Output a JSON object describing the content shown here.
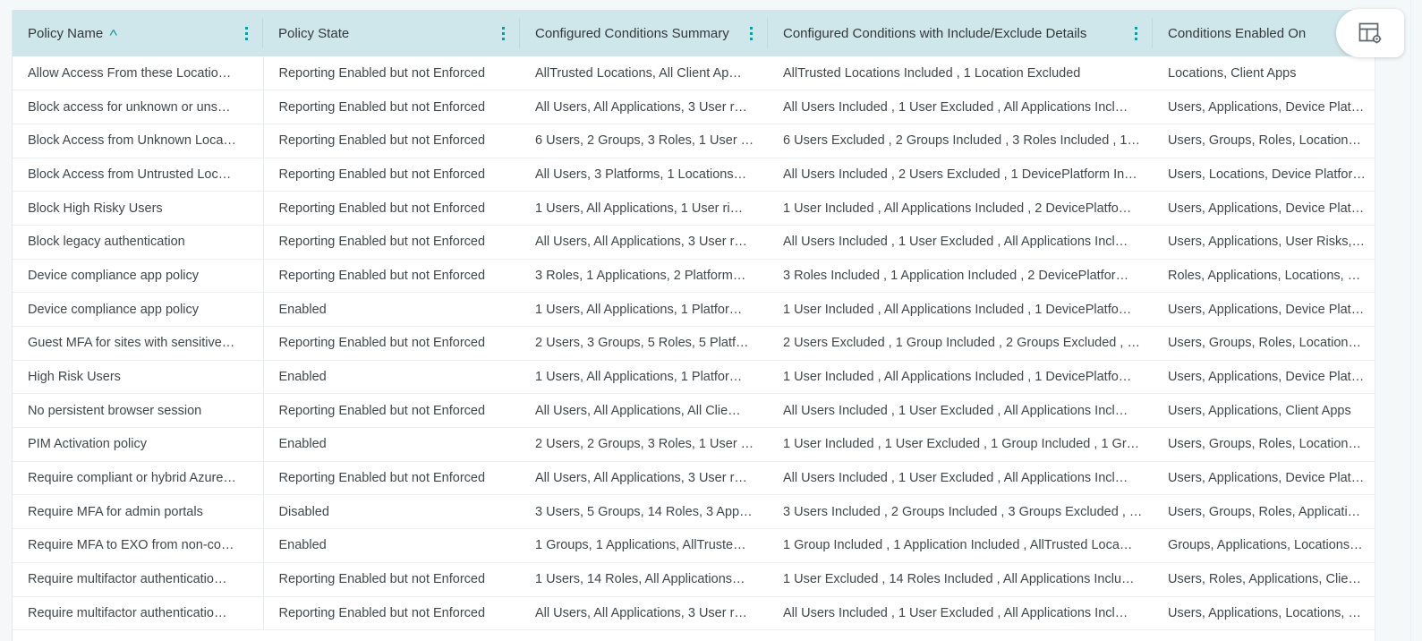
{
  "table": {
    "columns": [
      {
        "label": "Policy Name",
        "sorted": true,
        "sort_direction": "ascending",
        "sort_glyph": "˄",
        "has_menu": true
      },
      {
        "label": "Policy State",
        "sorted": false,
        "has_menu": true
      },
      {
        "label": "Configured Conditions Summary",
        "sorted": false,
        "has_menu": true
      },
      {
        "label": "Configured Conditions with Include/Exclude Details",
        "sorted": false,
        "has_menu": true
      },
      {
        "label": "Conditions Enabled On",
        "sorted": false,
        "has_menu": false
      }
    ],
    "rows": [
      {
        "policy_name": "Allow Access From these Locatio…",
        "policy_state": "Reporting Enabled but not Enforced",
        "conditions_summary": "AllTrusted Locations, All Client Ap…",
        "conditions_details": "AllTrusted Locations Included , 1 Location Excluded",
        "conditions_enabled_on": "Locations, Client Apps"
      },
      {
        "policy_name": "Block access for unknown or uns…",
        "policy_state": "Reporting Enabled but not Enforced",
        "conditions_summary": "All Users, All Applications, 3 User r…",
        "conditions_details": "All Users Included , 1 User Excluded , All Applications Incl…",
        "conditions_enabled_on": "Users, Applications, Device Platfor…"
      },
      {
        "policy_name": "Block Access from Unknown Loca…",
        "policy_state": "Reporting Enabled but not Enforced",
        "conditions_summary": "6 Users, 2 Groups, 3 Roles, 1 User …",
        "conditions_details": "6 Users Excluded , 2 Groups Included , 3 Roles Included , 1…",
        "conditions_enabled_on": "Users, Groups, Roles, Locations, D…"
      },
      {
        "policy_name": "Block Access from Untrusted Loc…",
        "policy_state": "Reporting Enabled but not Enforced",
        "conditions_summary": "All Users, 3 Platforms, 1 Locations…",
        "conditions_details": "All Users Included , 2 Users Excluded , 1 DevicePlatform In…",
        "conditions_enabled_on": "Users, Locations, Device Platform…"
      },
      {
        "policy_name": "Block High Risky Users",
        "policy_state": "Reporting Enabled but not Enforced",
        "conditions_summary": "1 Users, All Applications, 1 User ri…",
        "conditions_details": "1 User Included , All Applications Included , 2 DevicePlatfo…",
        "conditions_enabled_on": "Users, Applications, Device Platfor…"
      },
      {
        "policy_name": "Block legacy authentication",
        "policy_state": "Reporting Enabled but not Enforced",
        "conditions_summary": "All Users, All Applications, 3 User r…",
        "conditions_details": "All Users Included , 1 User Excluded , All Applications Incl…",
        "conditions_enabled_on": "Users, Applications, User Risks, Si…"
      },
      {
        "policy_name": "Device compliance app policy",
        "policy_state": "Reporting Enabled but not Enforced",
        "conditions_summary": "3 Roles, 1 Applications, 2 Platform…",
        "conditions_details": "3 Roles Included , 1 Application Included , 2 DevicePlatfor…",
        "conditions_enabled_on": "Roles, Applications, Locations, De…"
      },
      {
        "policy_name": "Device compliance app policy",
        "policy_state": "Enabled",
        "conditions_summary": "1 Users, All Applications, 1 Platfor…",
        "conditions_details": "1 User Included , All Applications Included , 1 DevicePlatfo…",
        "conditions_enabled_on": "Users, Applications, Device Platfor…"
      },
      {
        "policy_name": "Guest MFA for sites with sensitive…",
        "policy_state": "Reporting Enabled but not Enforced",
        "conditions_summary": "2 Users, 3 Groups, 5 Roles, 5 Platf…",
        "conditions_details": "2 Users Excluded , 1 Group Included , 2 Groups Excluded , …",
        "conditions_enabled_on": "Users, Groups, Roles, Locations, D…"
      },
      {
        "policy_name": "High Risk Users",
        "policy_state": "Enabled",
        "conditions_summary": "1 Users, All Applications, 1 Platfor…",
        "conditions_details": "1 User Included , All Applications Included , 1 DevicePlatfo…",
        "conditions_enabled_on": "Users, Applications, Device Platfor…"
      },
      {
        "policy_name": "No persistent browser session",
        "policy_state": "Reporting Enabled but not Enforced",
        "conditions_summary": "All Users, All Applications, All Clie…",
        "conditions_details": "All Users Included , 1 User Excluded , All Applications Incl…",
        "conditions_enabled_on": "Users, Applications, Client Apps"
      },
      {
        "policy_name": "PIM Activation policy",
        "policy_state": "Enabled",
        "conditions_summary": "2 Users, 2 Groups, 3 Roles, 1 User …",
        "conditions_details": "1 User Included , 1 User Excluded , 1 Group Included , 1 Gr…",
        "conditions_enabled_on": "Users, Groups, Roles, Locations, D…"
      },
      {
        "policy_name": "Require compliant or hybrid Azure…",
        "policy_state": "Reporting Enabled but not Enforced",
        "conditions_summary": "All Users, All Applications, 3 User r…",
        "conditions_details": "All Users Included , 1 User Excluded , All Applications Incl…",
        "conditions_enabled_on": "Users, Applications, Device Platfor…"
      },
      {
        "policy_name": "Require MFA for admin portals",
        "policy_state": "Disabled",
        "conditions_summary": "3 Users, 5 Groups, 14 Roles, 3 App…",
        "conditions_details": "3 Users Included , 2 Groups Included , 3 Groups Excluded , …",
        "conditions_enabled_on": "Users, Groups, Roles, Applications…"
      },
      {
        "policy_name": "Require MFA to EXO from non-co…",
        "policy_state": "Enabled",
        "conditions_summary": "1 Groups, 1 Applications, AllTruste…",
        "conditions_details": "1 Group Included , 1 Application Included , AllTrusted Loca…",
        "conditions_enabled_on": "Groups, Applications, Locations, C…"
      },
      {
        "policy_name": "Require multifactor authenticatio…",
        "policy_state": "Reporting Enabled but not Enforced",
        "conditions_summary": "1 Users, 14 Roles, All Applications…",
        "conditions_details": "1 User Excluded , 14 Roles Included , All Applications Inclu…",
        "conditions_enabled_on": "Users, Roles, Applications, Client …"
      },
      {
        "policy_name": "Require multifactor authenticatio…",
        "policy_state": "Reporting Enabled but not Enforced",
        "conditions_summary": "All Users, All Applications, 3 User r…",
        "conditions_details": "All Users Included , 1 User Excluded , All Applications Incl…",
        "conditions_enabled_on": "Users, Applications, Locations, Us…"
      }
    ]
  },
  "toolbar": {
    "column_settings_icon": "table-settings-icon"
  },
  "colors": {
    "header_background": "#cfe6eb",
    "accent_teal": "#15999b",
    "row_border": "#eceff1",
    "page_background": "#f4f8f9",
    "text": "#41474b"
  }
}
